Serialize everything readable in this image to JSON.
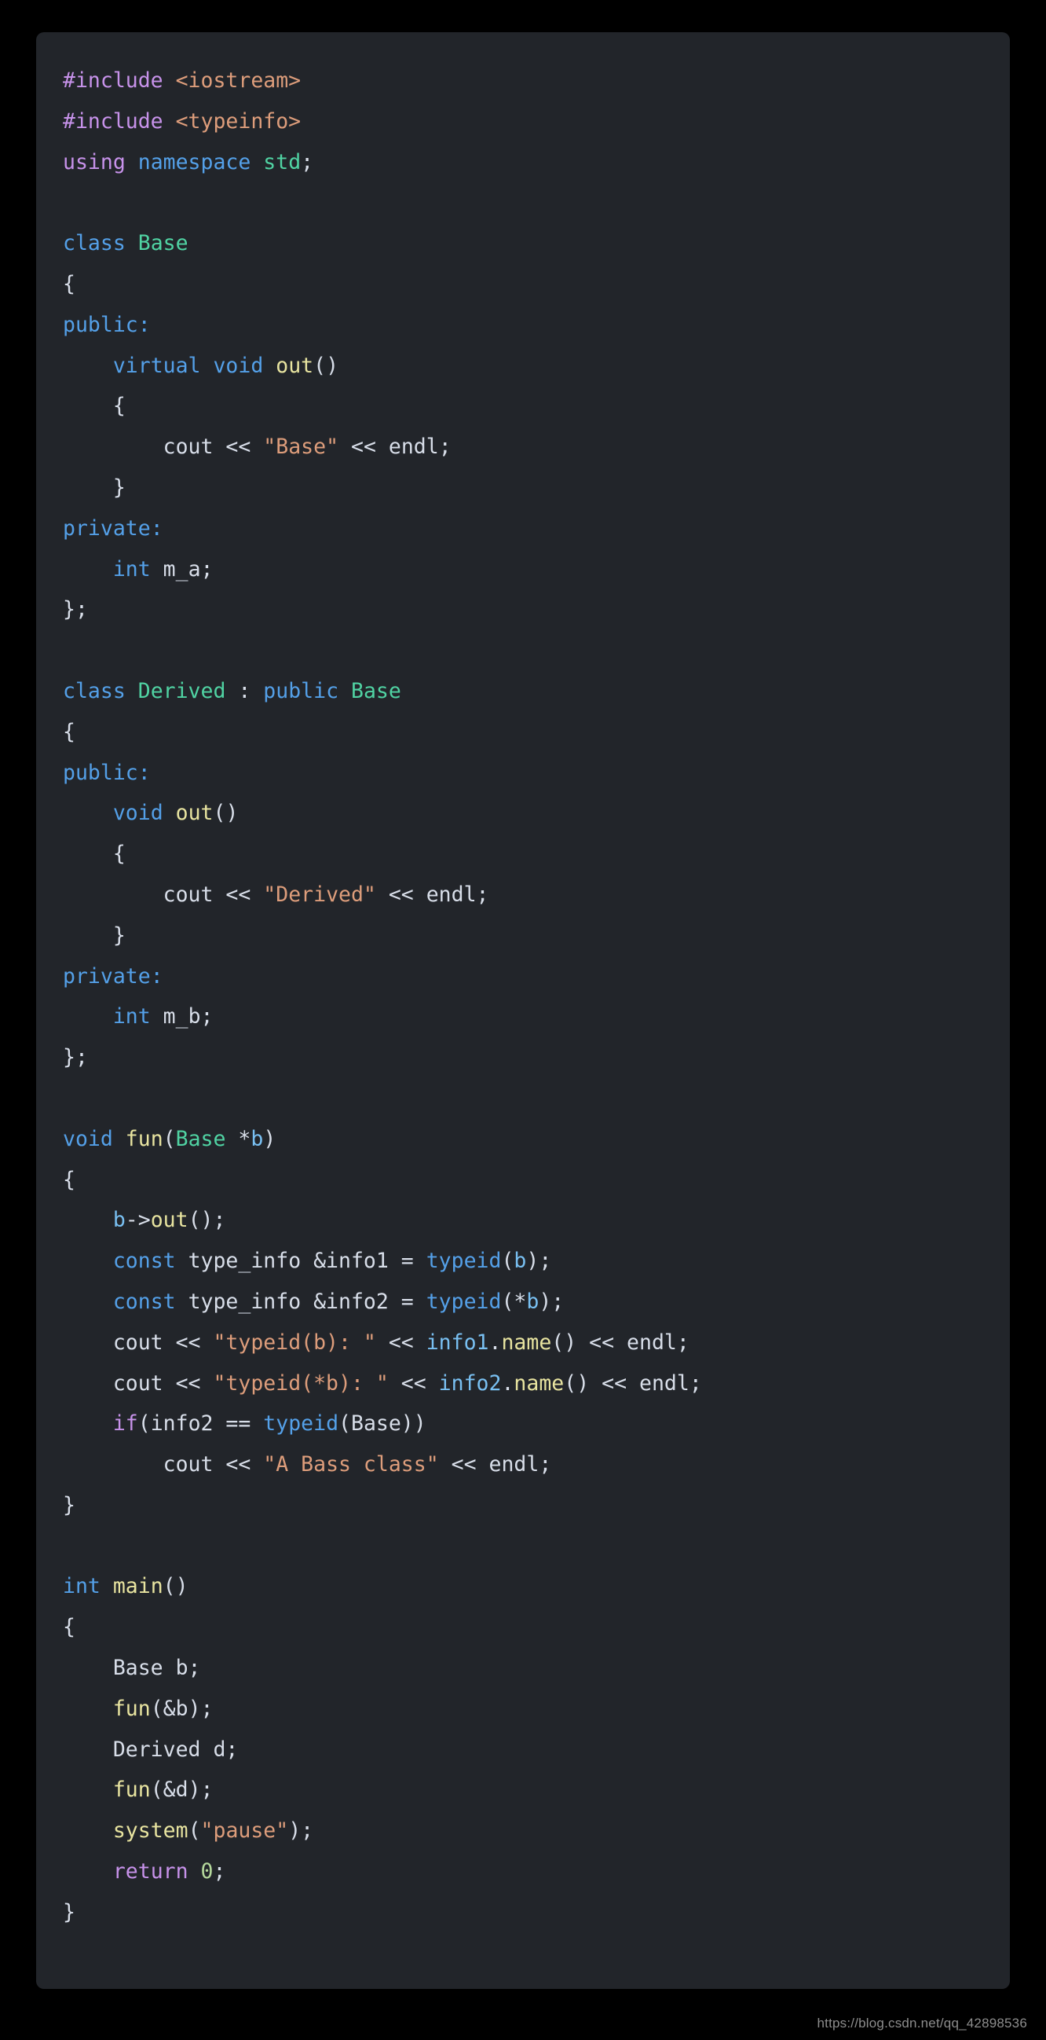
{
  "language": "cpp",
  "theme": {
    "page_background": "#000000",
    "card_background": "#22252a",
    "default_text": "#d8dee9",
    "preprocessor": "#c792ea",
    "header_name": "#dd9d7b",
    "keyword_magenta": "#c792ea",
    "keyword_blue": "#54a0e8",
    "type_green": "#50d3a3",
    "function_yellow": "#e8e4a0",
    "string_salmon": "#dd9d7b",
    "variable_blue": "#79c0f2",
    "number_green": "#b5d99c",
    "watermark_gray": "#8d8d8d"
  },
  "watermark": {
    "text": "https://blog.csdn.net/qq_42898536"
  },
  "code": {
    "line_count": 48,
    "plain_text": "#include <iostream>\n#include <typeinfo>\nusing namespace std;\n\nclass Base\n{\npublic:\n    virtual void out()\n    {\n        cout << \"Base\" << endl;\n    }\nprivate:\n    int m_a;\n};\n\nclass Derived : public Base\n{\npublic:\n    void out()\n    {\n        cout << \"Derived\" << endl;\n    }\nprivate:\n    int m_b;\n};\n\nvoid fun(Base *b)\n{\n    b->out();\n    const type_info &info1 = typeid(b);\n    const type_info &info2 = typeid(*b);\n    cout << \"typeid(b): \" << info1.name() << endl;\n    cout << \"typeid(*b): \" << info2.name() << endl;\n    if(info2 == typeid(Base))\n        cout << \"A Bass class\" << endl;\n}\n\nint main()\n{\n    Base b;\n    fun(&b);\n    Derived d;\n    fun(&d);\n    system(\"pause\");\n    return 0;\n}",
    "lines": [
      {
        "n": 1,
        "tokens": [
          {
            "t": "#include ",
            "c": "t-pre"
          },
          {
            "t": "<iostream>",
            "c": "t-header"
          }
        ]
      },
      {
        "n": 2,
        "tokens": [
          {
            "t": "#include ",
            "c": "t-pre"
          },
          {
            "t": "<typeinfo>",
            "c": "t-header"
          }
        ]
      },
      {
        "n": 3,
        "tokens": [
          {
            "t": "using ",
            "c": "t-kw"
          },
          {
            "t": "namespace ",
            "c": "t-ns"
          },
          {
            "t": "std",
            "c": "t-type"
          },
          {
            "t": ";",
            "c": "t-punct"
          }
        ]
      },
      {
        "n": 4,
        "tokens": []
      },
      {
        "n": 5,
        "tokens": [
          {
            "t": "class ",
            "c": "t-kw2"
          },
          {
            "t": "Base",
            "c": "t-type"
          }
        ]
      },
      {
        "n": 6,
        "tokens": [
          {
            "t": "{",
            "c": "t-punct"
          }
        ]
      },
      {
        "n": 7,
        "tokens": [
          {
            "t": "public",
            "c": "t-kw2"
          },
          {
            "t": ":",
            "c": "t-kw2"
          }
        ]
      },
      {
        "n": 8,
        "tokens": [
          {
            "t": "    ",
            "c": "t-plain"
          },
          {
            "t": "virtual ",
            "c": "t-kw2"
          },
          {
            "t": "void ",
            "c": "t-kw2"
          },
          {
            "t": "out",
            "c": "t-fn"
          },
          {
            "t": "()",
            "c": "t-punct"
          }
        ]
      },
      {
        "n": 9,
        "tokens": [
          {
            "t": "    {",
            "c": "t-punct"
          }
        ]
      },
      {
        "n": 10,
        "tokens": [
          {
            "t": "        cout ",
            "c": "t-plain"
          },
          {
            "t": "<< ",
            "c": "t-punct"
          },
          {
            "t": "\"Base\"",
            "c": "t-str"
          },
          {
            "t": " << ",
            "c": "t-punct"
          },
          {
            "t": "endl",
            "c": "t-plain"
          },
          {
            "t": ";",
            "c": "t-punct"
          }
        ]
      },
      {
        "n": 11,
        "tokens": [
          {
            "t": "    }",
            "c": "t-punct"
          }
        ]
      },
      {
        "n": 12,
        "tokens": [
          {
            "t": "private",
            "c": "t-kw2"
          },
          {
            "t": ":",
            "c": "t-kw2"
          }
        ]
      },
      {
        "n": 13,
        "tokens": [
          {
            "t": "    ",
            "c": "t-plain"
          },
          {
            "t": "int ",
            "c": "t-kw2"
          },
          {
            "t": "m_a",
            "c": "t-plain"
          },
          {
            "t": ";",
            "c": "t-punct"
          }
        ]
      },
      {
        "n": 14,
        "tokens": [
          {
            "t": "};",
            "c": "t-punct"
          }
        ]
      },
      {
        "n": 15,
        "tokens": []
      },
      {
        "n": 16,
        "tokens": [
          {
            "t": "class ",
            "c": "t-kw2"
          },
          {
            "t": "Derived",
            "c": "t-type"
          },
          {
            "t": " : ",
            "c": "t-punct"
          },
          {
            "t": "public ",
            "c": "t-kw2"
          },
          {
            "t": "Base",
            "c": "t-type"
          }
        ]
      },
      {
        "n": 17,
        "tokens": [
          {
            "t": "{",
            "c": "t-punct"
          }
        ]
      },
      {
        "n": 18,
        "tokens": [
          {
            "t": "public",
            "c": "t-kw2"
          },
          {
            "t": ":",
            "c": "t-kw2"
          }
        ]
      },
      {
        "n": 19,
        "tokens": [
          {
            "t": "    ",
            "c": "t-plain"
          },
          {
            "t": "void ",
            "c": "t-kw2"
          },
          {
            "t": "out",
            "c": "t-fn"
          },
          {
            "t": "()",
            "c": "t-punct"
          }
        ]
      },
      {
        "n": 20,
        "tokens": [
          {
            "t": "    {",
            "c": "t-punct"
          }
        ]
      },
      {
        "n": 21,
        "tokens": [
          {
            "t": "        cout ",
            "c": "t-plain"
          },
          {
            "t": "<< ",
            "c": "t-punct"
          },
          {
            "t": "\"Derived\"",
            "c": "t-str"
          },
          {
            "t": " << ",
            "c": "t-punct"
          },
          {
            "t": "endl",
            "c": "t-plain"
          },
          {
            "t": ";",
            "c": "t-punct"
          }
        ]
      },
      {
        "n": 22,
        "tokens": [
          {
            "t": "    }",
            "c": "t-punct"
          }
        ]
      },
      {
        "n": 23,
        "tokens": [
          {
            "t": "private",
            "c": "t-kw2"
          },
          {
            "t": ":",
            "c": "t-kw2"
          }
        ]
      },
      {
        "n": 24,
        "tokens": [
          {
            "t": "    ",
            "c": "t-plain"
          },
          {
            "t": "int ",
            "c": "t-kw2"
          },
          {
            "t": "m_b",
            "c": "t-plain"
          },
          {
            "t": ";",
            "c": "t-punct"
          }
        ]
      },
      {
        "n": 25,
        "tokens": [
          {
            "t": "};",
            "c": "t-punct"
          }
        ]
      },
      {
        "n": 26,
        "tokens": []
      },
      {
        "n": 27,
        "tokens": [
          {
            "t": "void ",
            "c": "t-kw2"
          },
          {
            "t": "fun",
            "c": "t-fn"
          },
          {
            "t": "(",
            "c": "t-punct"
          },
          {
            "t": "Base",
            "c": "t-type"
          },
          {
            "t": " *",
            "c": "t-punct"
          },
          {
            "t": "b",
            "c": "t-var"
          },
          {
            "t": ")",
            "c": "t-punct"
          }
        ]
      },
      {
        "n": 28,
        "tokens": [
          {
            "t": "{",
            "c": "t-punct"
          }
        ]
      },
      {
        "n": 29,
        "tokens": [
          {
            "t": "    ",
            "c": "t-plain"
          },
          {
            "t": "b",
            "c": "t-var"
          },
          {
            "t": "->",
            "c": "t-punct"
          },
          {
            "t": "out",
            "c": "t-fn"
          },
          {
            "t": "();",
            "c": "t-punct"
          }
        ]
      },
      {
        "n": 30,
        "tokens": [
          {
            "t": "    ",
            "c": "t-plain"
          },
          {
            "t": "const ",
            "c": "t-kw2"
          },
          {
            "t": "type_info &info1 = ",
            "c": "t-plain"
          },
          {
            "t": "typeid",
            "c": "t-kw2"
          },
          {
            "t": "(",
            "c": "t-punct"
          },
          {
            "t": "b",
            "c": "t-var"
          },
          {
            "t": ");",
            "c": "t-punct"
          }
        ]
      },
      {
        "n": 31,
        "tokens": [
          {
            "t": "    ",
            "c": "t-plain"
          },
          {
            "t": "const ",
            "c": "t-kw2"
          },
          {
            "t": "type_info &info2 = ",
            "c": "t-plain"
          },
          {
            "t": "typeid",
            "c": "t-kw2"
          },
          {
            "t": "(*",
            "c": "t-punct"
          },
          {
            "t": "b",
            "c": "t-var"
          },
          {
            "t": ");",
            "c": "t-punct"
          }
        ]
      },
      {
        "n": 32,
        "tokens": [
          {
            "t": "    cout ",
            "c": "t-plain"
          },
          {
            "t": "<< ",
            "c": "t-punct"
          },
          {
            "t": "\"typeid(b): \"",
            "c": "t-str"
          },
          {
            "t": " << ",
            "c": "t-punct"
          },
          {
            "t": "info1",
            "c": "t-var"
          },
          {
            "t": ".",
            "c": "t-punct"
          },
          {
            "t": "name",
            "c": "t-fn"
          },
          {
            "t": "() ",
            "c": "t-punct"
          },
          {
            "t": "<< ",
            "c": "t-punct"
          },
          {
            "t": "endl",
            "c": "t-plain"
          },
          {
            "t": ";",
            "c": "t-punct"
          }
        ]
      },
      {
        "n": 33,
        "tokens": [
          {
            "t": "    cout ",
            "c": "t-plain"
          },
          {
            "t": "<< ",
            "c": "t-punct"
          },
          {
            "t": "\"typeid(*b): \"",
            "c": "t-str"
          },
          {
            "t": " << ",
            "c": "t-punct"
          },
          {
            "t": "info2",
            "c": "t-var"
          },
          {
            "t": ".",
            "c": "t-punct"
          },
          {
            "t": "name",
            "c": "t-fn"
          },
          {
            "t": "() ",
            "c": "t-punct"
          },
          {
            "t": "<< ",
            "c": "t-punct"
          },
          {
            "t": "endl",
            "c": "t-plain"
          },
          {
            "t": ";",
            "c": "t-punct"
          }
        ]
      },
      {
        "n": 34,
        "tokens": [
          {
            "t": "    ",
            "c": "t-plain"
          },
          {
            "t": "if",
            "c": "t-kw"
          },
          {
            "t": "(info2 == ",
            "c": "t-plain"
          },
          {
            "t": "typeid",
            "c": "t-kw2"
          },
          {
            "t": "(Base))",
            "c": "t-plain"
          }
        ]
      },
      {
        "n": 35,
        "tokens": [
          {
            "t": "        cout ",
            "c": "t-plain"
          },
          {
            "t": "<< ",
            "c": "t-punct"
          },
          {
            "t": "\"A Bass class\"",
            "c": "t-str"
          },
          {
            "t": " << ",
            "c": "t-punct"
          },
          {
            "t": "endl",
            "c": "t-plain"
          },
          {
            "t": ";",
            "c": "t-punct"
          }
        ]
      },
      {
        "n": 36,
        "tokens": [
          {
            "t": "}",
            "c": "t-punct"
          }
        ]
      },
      {
        "n": 37,
        "tokens": []
      },
      {
        "n": 38,
        "tokens": [
          {
            "t": "int ",
            "c": "t-kw2"
          },
          {
            "t": "main",
            "c": "t-fn"
          },
          {
            "t": "()",
            "c": "t-punct"
          }
        ]
      },
      {
        "n": 39,
        "tokens": [
          {
            "t": "{",
            "c": "t-punct"
          }
        ]
      },
      {
        "n": 40,
        "tokens": [
          {
            "t": "    Base b;",
            "c": "t-plain"
          }
        ]
      },
      {
        "n": 41,
        "tokens": [
          {
            "t": "    ",
            "c": "t-plain"
          },
          {
            "t": "fun",
            "c": "t-fn"
          },
          {
            "t": "(&b);",
            "c": "t-punct"
          }
        ]
      },
      {
        "n": 42,
        "tokens": [
          {
            "t": "    Derived d;",
            "c": "t-plain"
          }
        ]
      },
      {
        "n": 43,
        "tokens": [
          {
            "t": "    ",
            "c": "t-plain"
          },
          {
            "t": "fun",
            "c": "t-fn"
          },
          {
            "t": "(&d);",
            "c": "t-punct"
          }
        ]
      },
      {
        "n": 44,
        "tokens": [
          {
            "t": "    ",
            "c": "t-plain"
          },
          {
            "t": "system",
            "c": "t-fn"
          },
          {
            "t": "(",
            "c": "t-punct"
          },
          {
            "t": "\"pause\"",
            "c": "t-str"
          },
          {
            "t": ");",
            "c": "t-punct"
          }
        ]
      },
      {
        "n": 45,
        "tokens": [
          {
            "t": "    ",
            "c": "t-plain"
          },
          {
            "t": "return ",
            "c": "t-kw"
          },
          {
            "t": "0",
            "c": "t-num"
          },
          {
            "t": ";",
            "c": "t-punct"
          }
        ]
      },
      {
        "n": 46,
        "tokens": [
          {
            "t": "}",
            "c": "t-punct"
          }
        ]
      }
    ]
  }
}
